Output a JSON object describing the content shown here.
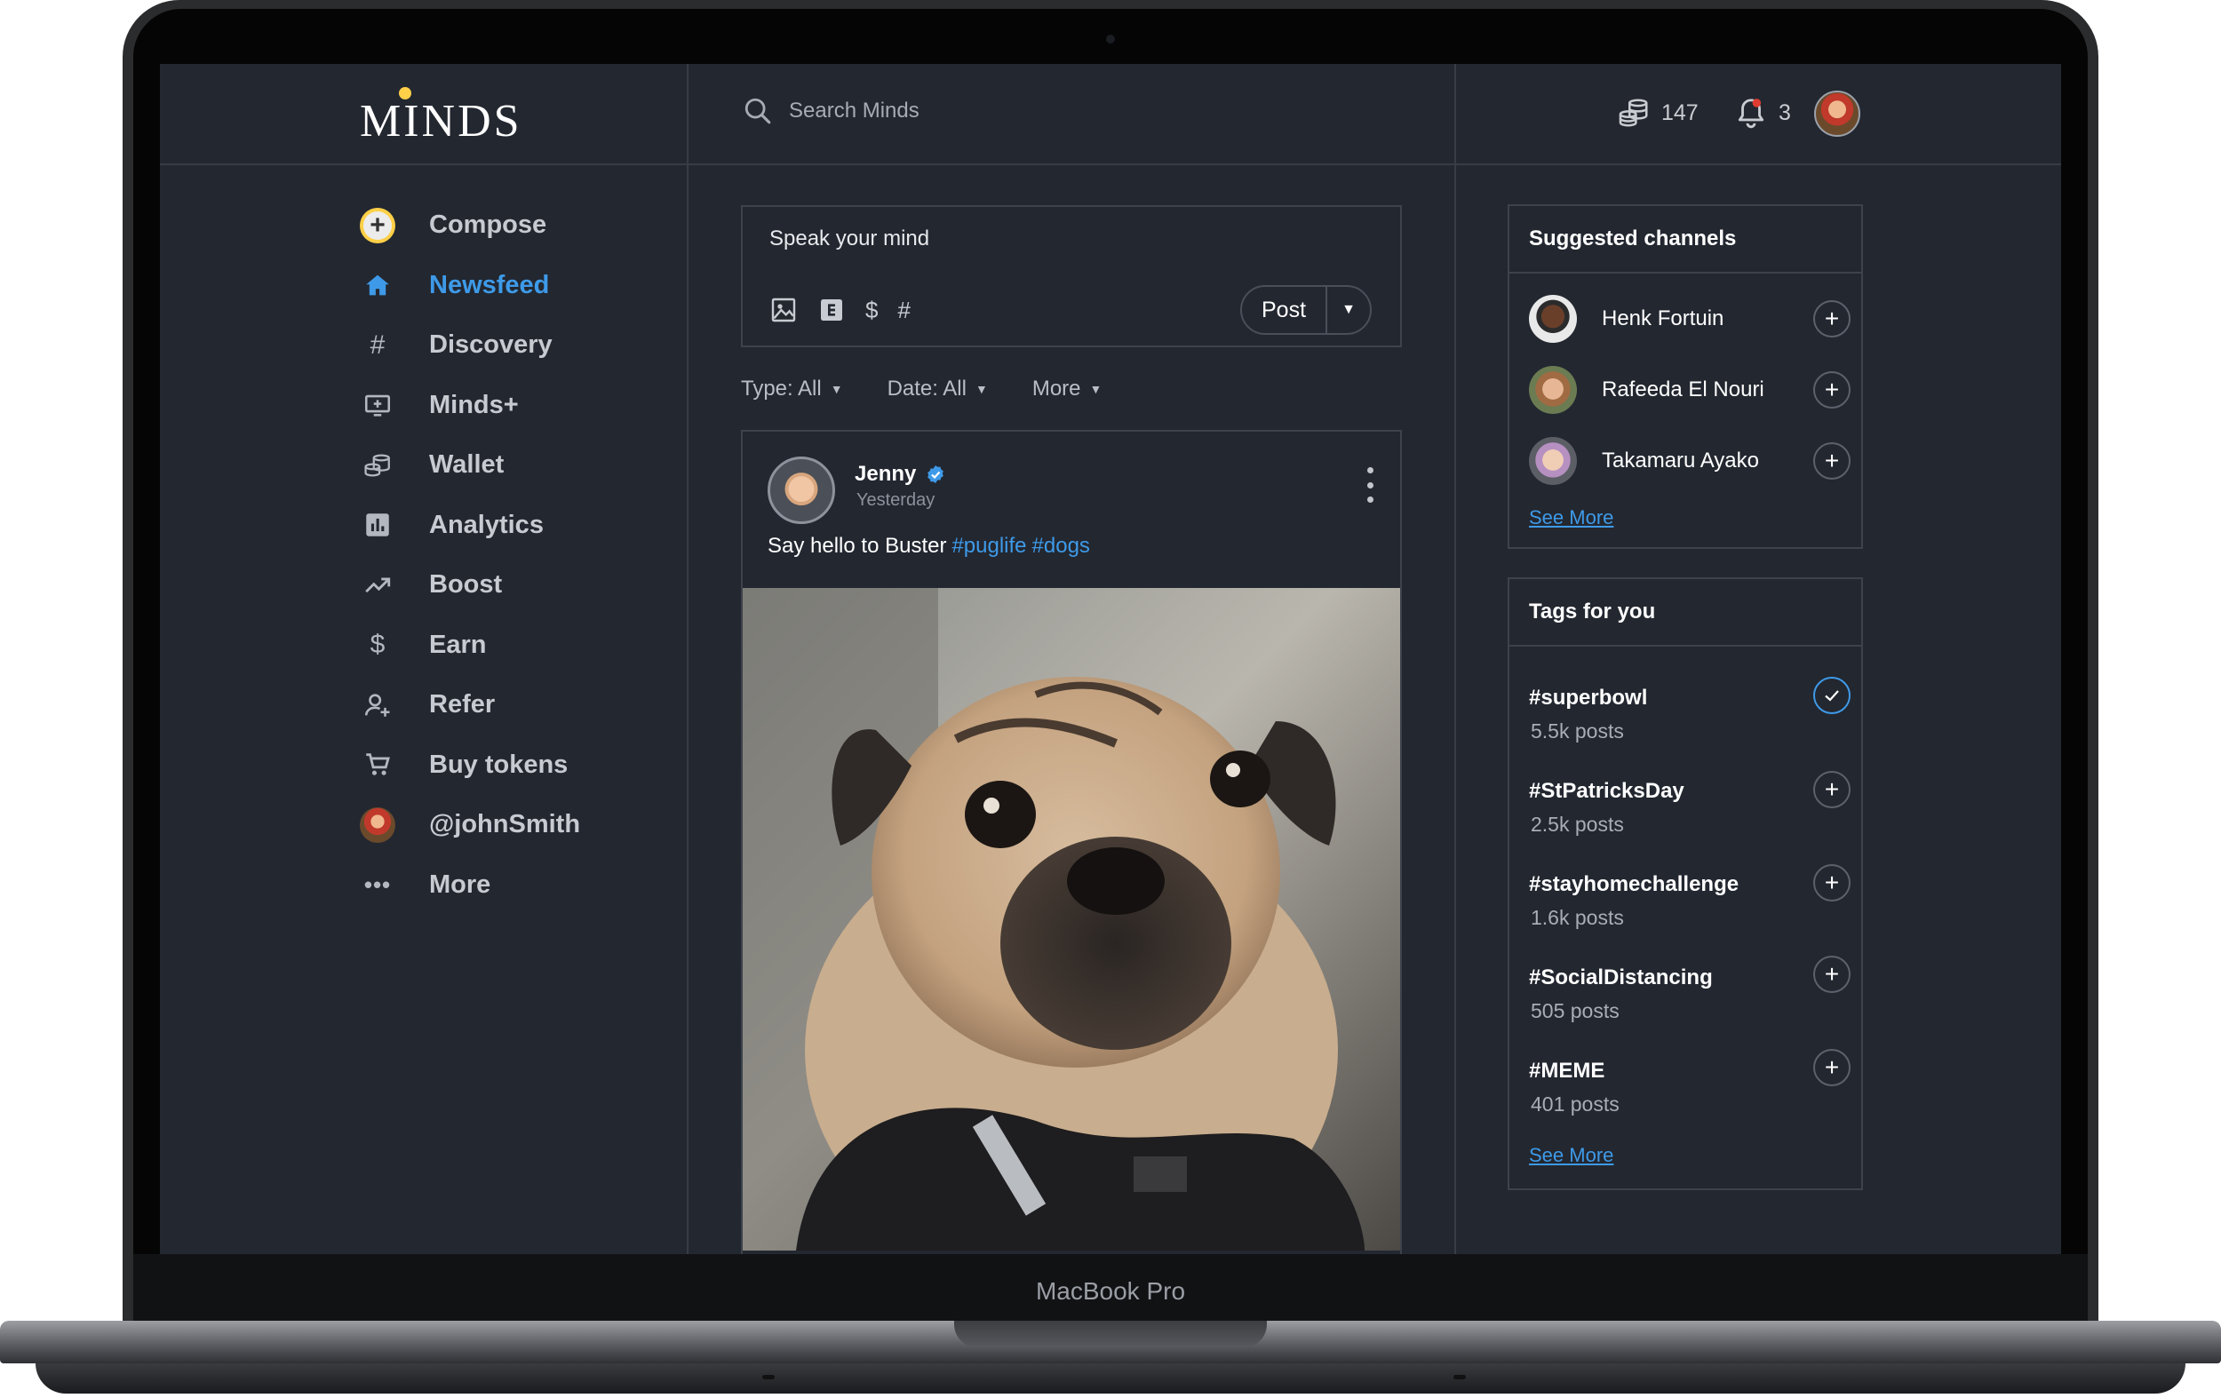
{
  "device": {
    "model_label": "MacBook Pro"
  },
  "brand": {
    "logo_text": "MINDS",
    "accent_color": "#3e9ae8",
    "logo_dot_color": "#ffd048"
  },
  "header": {
    "search_placeholder": "Search Minds",
    "tokens_count": "147",
    "notifications_count": "3",
    "icons": [
      "search-icon",
      "tokens-icon",
      "bell-icon",
      "avatar"
    ]
  },
  "sidebar": {
    "items": [
      {
        "label": "Compose",
        "icon": "compose-plus-icon",
        "active": false
      },
      {
        "label": "Newsfeed",
        "icon": "home-icon",
        "active": true
      },
      {
        "label": "Discovery",
        "icon": "hash-icon",
        "active": false
      },
      {
        "label": "Minds+",
        "icon": "monitor-plus-icon",
        "active": false
      },
      {
        "label": "Wallet",
        "icon": "coins-icon",
        "active": false
      },
      {
        "label": "Analytics",
        "icon": "bar-chart-icon",
        "active": false
      },
      {
        "label": "Boost",
        "icon": "trending-up-icon",
        "active": false
      },
      {
        "label": "Earn",
        "icon": "dollar-icon",
        "active": false
      },
      {
        "label": "Refer",
        "icon": "person-add-icon",
        "active": false
      },
      {
        "label": "Buy tokens",
        "icon": "cart-icon",
        "active": false
      },
      {
        "label": "@johnSmith",
        "icon": "user-avatar",
        "active": false
      },
      {
        "label": "More",
        "icon": "more-dots-icon",
        "active": false
      }
    ]
  },
  "composer": {
    "placeholder": "Speak your mind",
    "post_label": "Post",
    "tools": [
      "image-icon",
      "explicit-icon",
      "dollar-icon",
      "hash-icon"
    ]
  },
  "filters": [
    {
      "label": "Type: All"
    },
    {
      "label": "Date: All"
    },
    {
      "label": "More"
    }
  ],
  "post": {
    "author": "Jenny",
    "verified": true,
    "time": "Yesterday",
    "text": "Say hello to Buster",
    "tags": [
      "#puglife",
      "#dogs"
    ]
  },
  "suggested_channels": {
    "title": "Suggested channels",
    "items": [
      {
        "name": "Henk Fortuin"
      },
      {
        "name": "Rafeeda El Nouri"
      },
      {
        "name": "Takamaru Ayako"
      }
    ],
    "see_more": "See More"
  },
  "tags_for_you": {
    "title": "Tags for you",
    "items": [
      {
        "tag": "#superbowl",
        "count": "5.5k posts",
        "followed": true
      },
      {
        "tag": "#StPatricksDay",
        "count": "2.5k posts",
        "followed": false
      },
      {
        "tag": "#stayhomechallenge",
        "count": "1.6k posts",
        "followed": false
      },
      {
        "tag": "#SocialDistancing",
        "count": "505 posts",
        "followed": false
      },
      {
        "tag": "#MEME",
        "count": "401 posts",
        "followed": false
      }
    ],
    "see_more": "See More"
  }
}
